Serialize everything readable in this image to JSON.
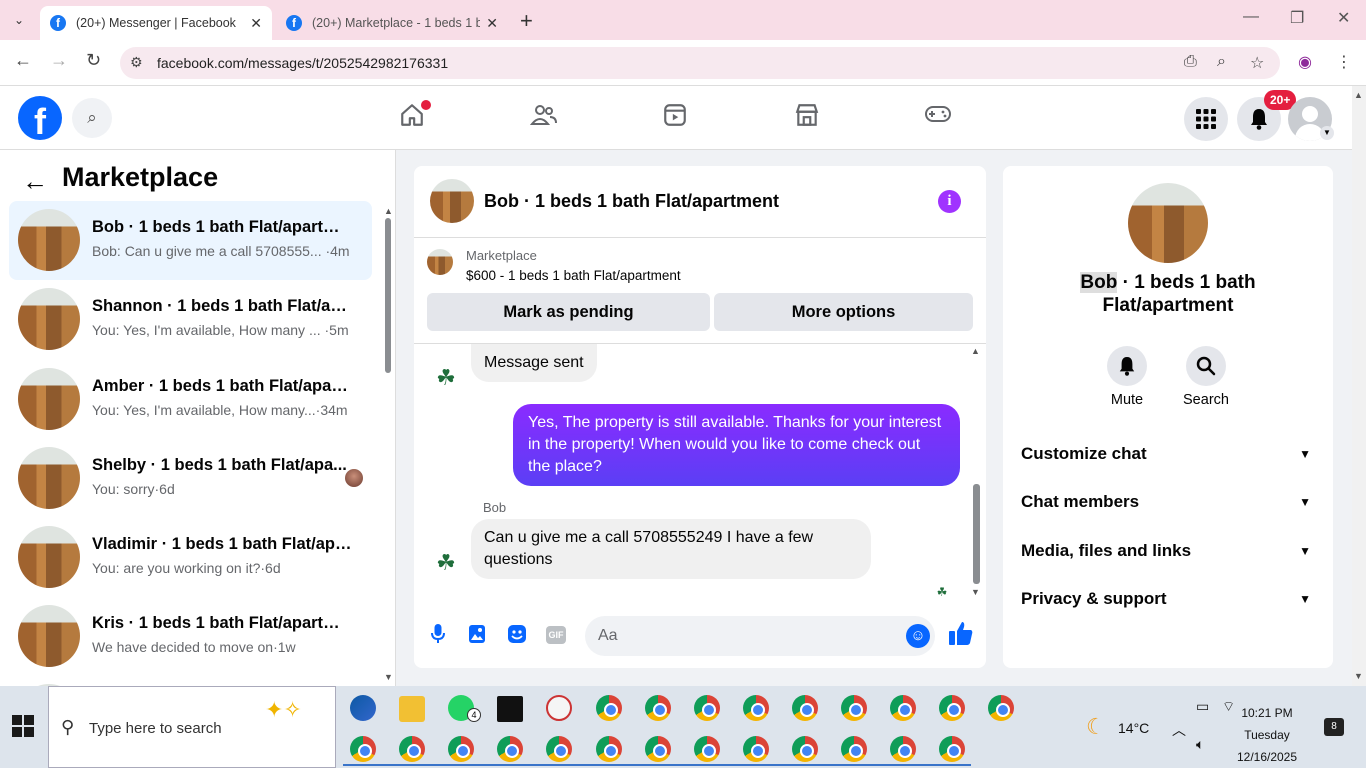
{
  "browser": {
    "tabs": [
      {
        "title": "(20+) Messenger | Facebook",
        "active": true
      },
      {
        "title": "(20+) Marketplace - 1 beds 1 b",
        "active": false
      }
    ],
    "url": "facebook.com/messages/t/2052542982176331"
  },
  "fb_nav": {
    "logo": "f",
    "notifications_badge": "20+",
    "icons": [
      "home-icon",
      "friends-icon",
      "watch-icon",
      "marketplace-icon",
      "gaming-icon"
    ]
  },
  "left_panel": {
    "title": "Marketplace",
    "conversations": [
      {
        "name": "Bob · 1 beds 1 bath Flat/apartment",
        "preview": "Bob: Can u give me a call 5708555... ·4m",
        "active": true
      },
      {
        "name": "Shannon · 1 beds 1 bath Flat/apa...",
        "preview": "You: Yes, I'm available, How many ... ·5m",
        "active": false
      },
      {
        "name": "Amber · 1 beds 1 bath Flat/apart...",
        "preview": "You: Yes, I'm available, How many...·34m",
        "active": false
      },
      {
        "name": "Shelby · 1 beds 1 bath Flat/apa...",
        "preview": "You: sorry·6d",
        "active": false
      },
      {
        "name": "Vladimir · 1 beds 1 bath Flat/apa...",
        "preview": "You: are you working on it?·6d",
        "active": false
      },
      {
        "name": "Kris · 1 beds 1 bath Flat/apartment",
        "preview": "We have decided to move on·1w",
        "active": false
      }
    ]
  },
  "chat": {
    "header_name": "Bob · 1 beds 1 bath Flat/apartment",
    "marketplace_label": "Marketplace",
    "listing": "$600 - 1 beds 1 bath Flat/apartment",
    "mark_pending": "Mark as pending",
    "more_options": "More options",
    "messages": {
      "sent_status": "Message sent",
      "outgoing": "Yes, The property is still available. Thanks for your interest in the property! When would you like to come check out the place?",
      "sender": "Bob",
      "incoming": "Can u give me a call 5708555249 I have a few questions"
    },
    "composer_placeholder": "Aa"
  },
  "right_panel": {
    "title_highlight": "Bob",
    "title_rest": " · 1 beds 1 bath Flat/apartment",
    "actions": [
      {
        "label": "Mute"
      },
      {
        "label": "Search"
      }
    ],
    "sections": [
      "Customize chat",
      "Chat members",
      "Media, files and links",
      "Privacy & support"
    ]
  },
  "taskbar": {
    "search_placeholder": "Type here to search",
    "temperature": "14°C",
    "time": "10:21 PM",
    "day": "Tuesday",
    "date": "12/16/2025",
    "whatsapp_badge": "4",
    "notification_count": "8"
  }
}
